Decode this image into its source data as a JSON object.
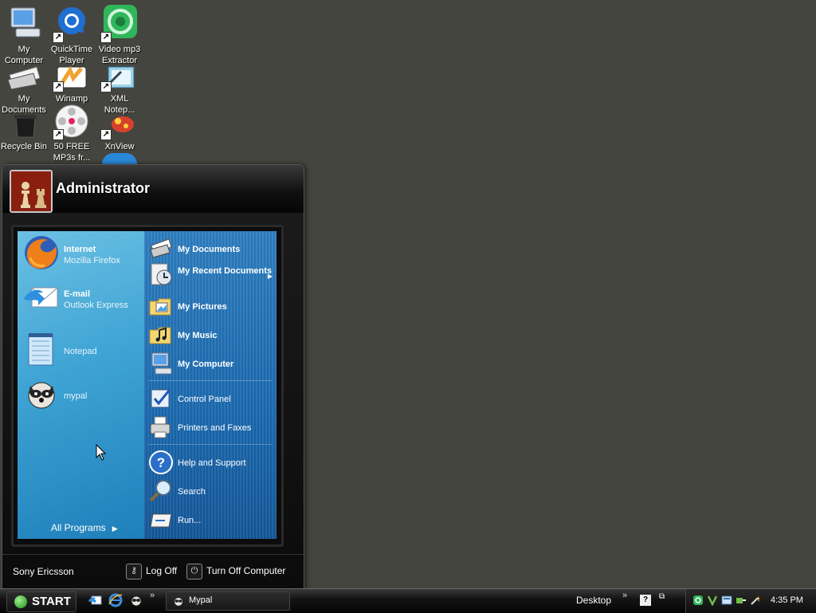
{
  "desktop": {
    "icons": [
      {
        "label": "My Computer",
        "icon": "my-computer-icon",
        "shortcut": false
      },
      {
        "label": "QuickTime Player",
        "icon": "quicktime-icon",
        "shortcut": true
      },
      {
        "label": "Video mp3 Extractor",
        "icon": "video-mp3-extractor-icon",
        "shortcut": true
      },
      {
        "label": "My Documents",
        "icon": "my-documents-icon",
        "shortcut": false
      },
      {
        "label": "Winamp",
        "icon": "winamp-icon",
        "shortcut": true
      },
      {
        "label": "XML Notep...",
        "icon": "xml-notepad-icon",
        "shortcut": true
      },
      {
        "label": "Recycle Bin",
        "icon": "recycle-bin-icon",
        "shortcut": false
      },
      {
        "label": "50 FREE MP3s fr...",
        "icon": "mp3-film-reel-icon",
        "shortcut": true
      },
      {
        "label": "XnView",
        "icon": "xnview-icon",
        "shortcut": true
      }
    ]
  },
  "start_menu": {
    "user": "Administrator",
    "pinned": [
      {
        "title": "Internet",
        "subtitle": "Mozilla Firefox",
        "icon": "firefox-icon"
      },
      {
        "title": "E-mail",
        "subtitle": "Outlook Express",
        "icon": "outlook-express-icon"
      }
    ],
    "recent": [
      {
        "title": "Notepad",
        "icon": "notepad-icon"
      },
      {
        "title": "mypal",
        "icon": "mypal-raccoon-icon"
      }
    ],
    "all_programs": "All Programs",
    "places": [
      {
        "label": "My Documents",
        "icon": "my-documents-icon",
        "bold": true
      },
      {
        "label": "My Recent Documents",
        "icon": "recent-documents-icon",
        "bold": true,
        "submenu": true
      },
      {
        "label": "My Pictures",
        "icon": "my-pictures-icon",
        "bold": true
      },
      {
        "label": "My Music",
        "icon": "my-music-icon",
        "bold": true
      },
      {
        "label": "My Computer",
        "icon": "my-computer-icon",
        "bold": true
      },
      {
        "label": "Control Panel",
        "icon": "control-panel-icon",
        "bold": false
      },
      {
        "label": "Printers and Faxes",
        "icon": "printers-faxes-icon",
        "bold": false
      },
      {
        "label": "Help and Support",
        "icon": "help-support-icon",
        "bold": false
      },
      {
        "label": "Search",
        "icon": "search-icon",
        "bold": false
      },
      {
        "label": "Run...",
        "icon": "run-icon",
        "bold": false
      }
    ],
    "footer": {
      "brand": "Sony Ericsson",
      "log_off": "Log Off",
      "turn_off": "Turn Off Computer"
    }
  },
  "taskbar": {
    "start_label": "START",
    "quick_launch": [
      "outlook-express-icon",
      "internet-explorer-icon",
      "mypal-icon"
    ],
    "more": "»",
    "tasks": [
      {
        "label": "Mypal",
        "icon": "mypal-icon"
      }
    ],
    "desktop_toolbar": "Desktop",
    "help": "?",
    "tray_icons": [
      "network-icon",
      "antivirus-icon",
      "messenger-icon",
      "connection-icon",
      "magic-wand-icon"
    ],
    "clock": "4:35 PM"
  },
  "colors": {
    "desktop_bg": "#45453f",
    "menu_left_blue": "#3ea3d4",
    "menu_right_blue": "#1b6aaf",
    "taskbar_black": "#0d0d0d"
  }
}
